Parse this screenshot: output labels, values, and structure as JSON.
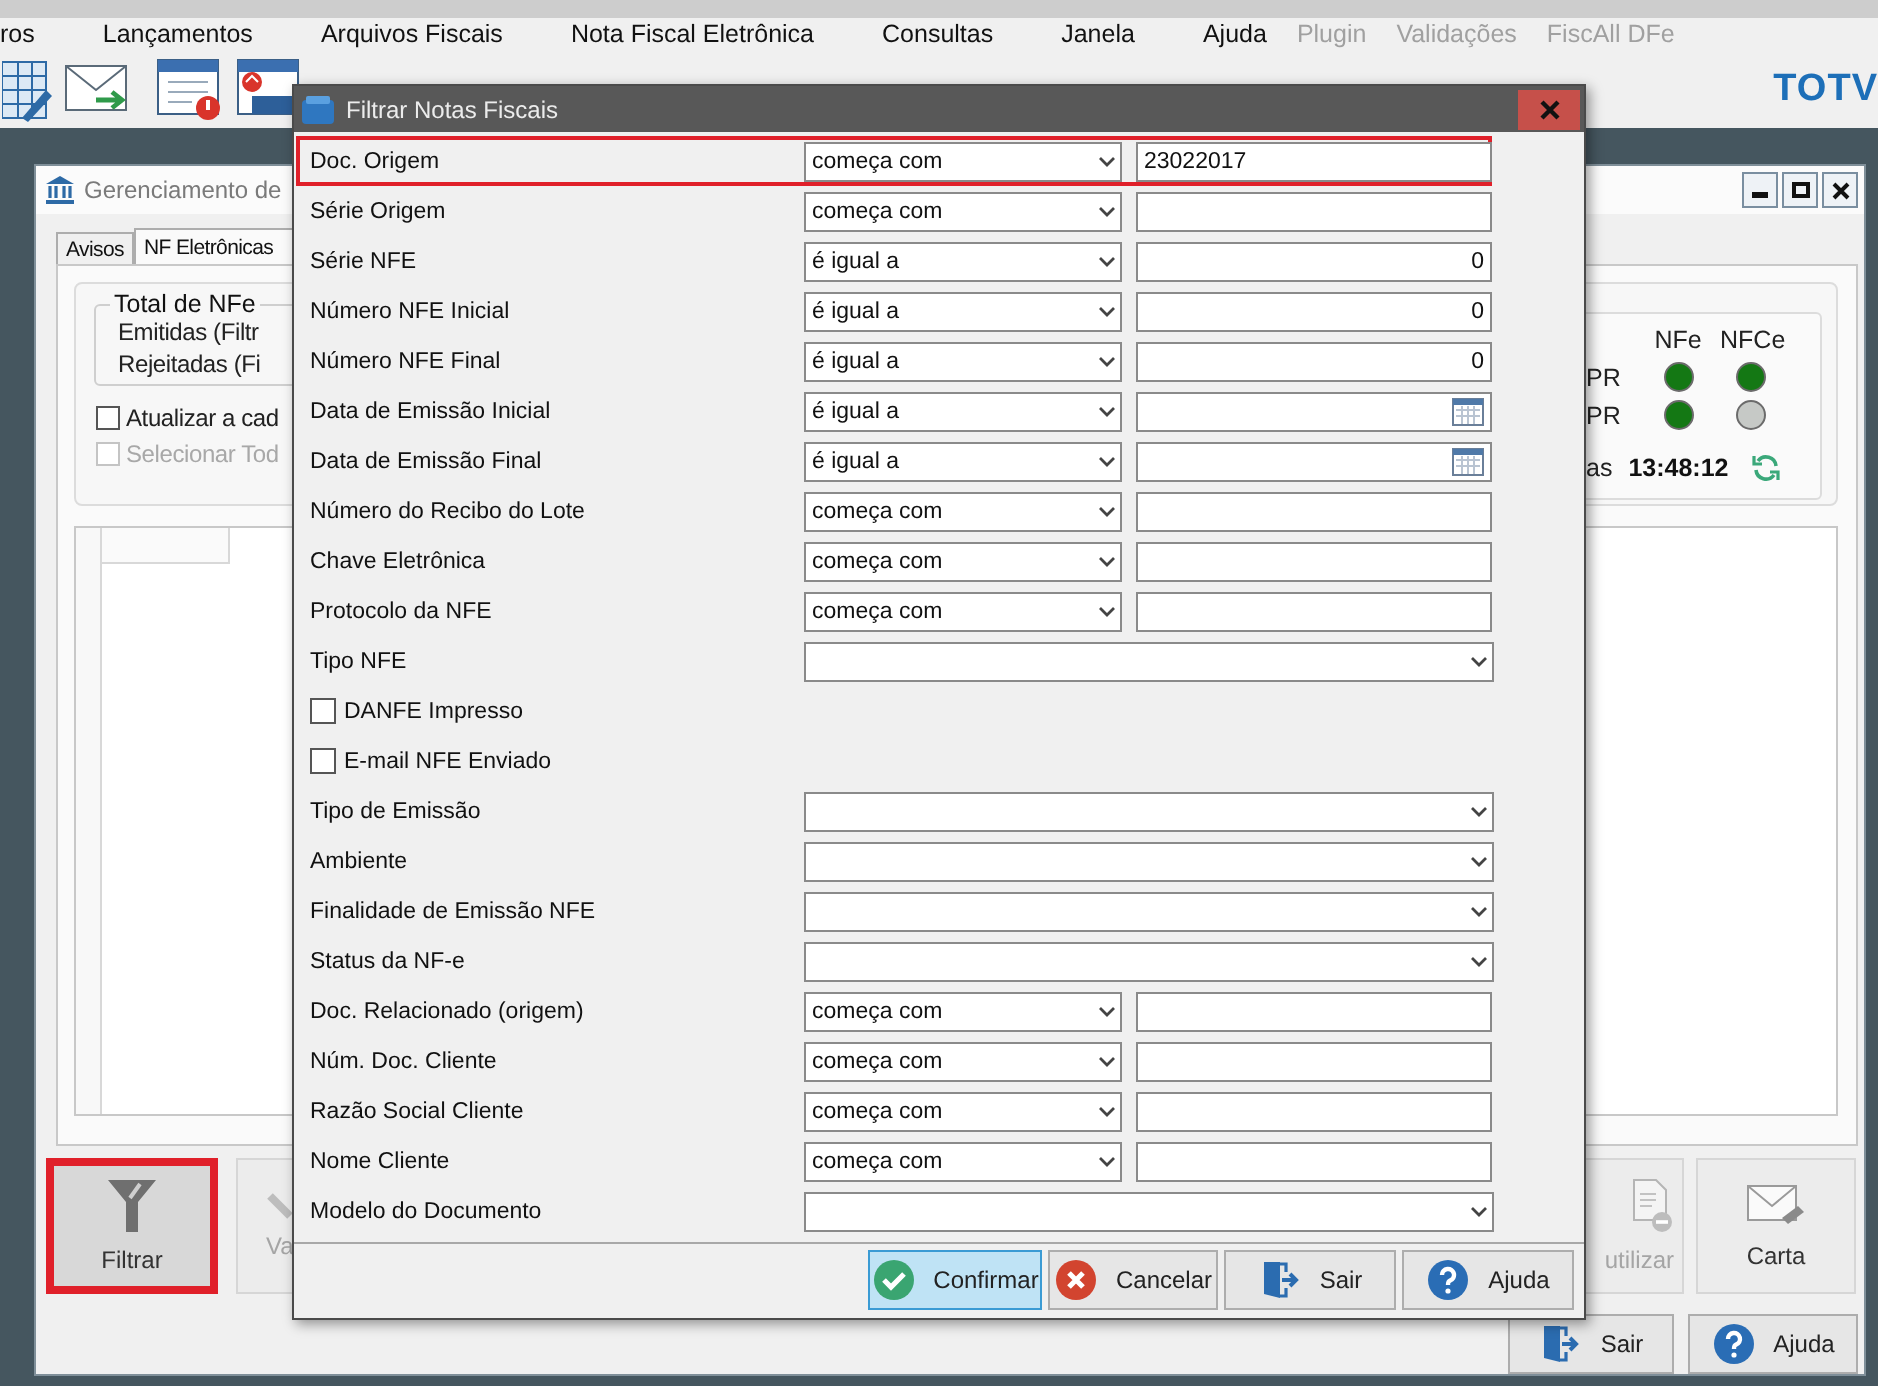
{
  "menu": [
    {
      "label": "ros",
      "disabled": false
    },
    {
      "label": "Lançamentos",
      "disabled": false
    },
    {
      "label": "Arquivos Fiscais",
      "disabled": false
    },
    {
      "label": "Nota Fiscal Eletrônica",
      "disabled": false
    },
    {
      "label": "Consultas",
      "disabled": false
    },
    {
      "label": "Janela",
      "disabled": false
    },
    {
      "label": "Ajuda",
      "disabled": false
    },
    {
      "label": "Plugin",
      "disabled": true
    },
    {
      "label": "Validações",
      "disabled": true
    },
    {
      "label": "FiscAll DFe",
      "disabled": true
    }
  ],
  "toolbar": {
    "tools": [
      {
        "kind": "grid"
      },
      {
        "kind": "mail"
      },
      {
        "kind": "calendar"
      },
      {
        "kind": "tax"
      }
    ],
    "brand": "TOTV"
  },
  "window": {
    "title": "Gerenciamento de",
    "tabs": [
      {
        "label": "Avisos",
        "selected": false
      },
      {
        "label": "NF Eletrônicas",
        "selected": true
      }
    ],
    "totals": {
      "title": "Total de NFe",
      "lines": [
        "Emitidas (Filtr",
        "Rejeitadas (Fi"
      ]
    },
    "options": [
      {
        "label": "Atualizar a cad",
        "checked": false,
        "disabled": false
      },
      {
        "label": "Selecionar Tod",
        "checked": false,
        "disabled": true
      }
    ],
    "status": {
      "columns": [
        "NFe",
        "NFCe"
      ],
      "rows": [
        {
          "label": "PR",
          "lights": [
            {
              "color": "#147814"
            },
            {
              "color": "#147814"
            }
          ]
        },
        {
          "label": "PR",
          "lights": [
            {
              "color": "#147814"
            },
            {
              "color": "#c6c9c6"
            }
          ]
        }
      ],
      "time_label": "as",
      "time": "13:48:12"
    },
    "actions": [
      {
        "label": "Filtrar",
        "kind": "filter",
        "disabled": false,
        "highlighted": true
      },
      {
        "label": "Va",
        "kind": "edit",
        "disabled": true,
        "highlighted": false
      }
    ],
    "right_actions": [
      {
        "label": "utilizar",
        "kind": "void",
        "disabled": true
      },
      {
        "label": "Carta",
        "kind": "letter",
        "disabled": false
      }
    ],
    "footer_buttons": [
      {
        "label": "Sair",
        "kind": "exit"
      },
      {
        "label": "Ajuda",
        "kind": "help"
      }
    ]
  },
  "dialog": {
    "title": "Filtrar Notas Fiscais",
    "fields": [
      {
        "kind": "text",
        "label": "Doc. Origem",
        "operator": "começa com",
        "value": "23022017",
        "highlighted": true
      },
      {
        "kind": "text",
        "label": "Série Origem",
        "operator": "começa com",
        "highlighted": false
      },
      {
        "kind": "number",
        "label": "Série NFE",
        "operator": "é igual a",
        "value": "0",
        "highlighted": false
      },
      {
        "kind": "number",
        "label": "Número NFE Inicial",
        "operator": "é igual a",
        "value": "0",
        "highlighted": false
      },
      {
        "kind": "number",
        "label": "Número NFE Final",
        "operator": "é igual a",
        "value": "0",
        "highlighted": false
      },
      {
        "kind": "date",
        "label": "Data de Emissão Inicial",
        "operator": "é igual a",
        "highlighted": false
      },
      {
        "kind": "date",
        "label": "Data de Emissão Final",
        "operator": "é igual a",
        "highlighted": false
      },
      {
        "kind": "text",
        "label": "Número do Recibo do Lote",
        "operator": "começa com",
        "highlighted": false
      },
      {
        "kind": "text",
        "label": "Chave Eletrônica",
        "operator": "começa com",
        "highlighted": false
      },
      {
        "kind": "text",
        "label": "Protocolo da NFE",
        "operator": "começa com",
        "highlighted": false
      },
      {
        "kind": "select",
        "label": "Tipo NFE",
        "highlighted": false
      },
      {
        "kind": "checkbox",
        "label": "DANFE Impresso",
        "checked": false,
        "highlighted": false
      },
      {
        "kind": "checkbox",
        "label": "E-mail NFE Enviado",
        "checked": false,
        "highlighted": false
      },
      {
        "kind": "select",
        "label": "Tipo de Emissão",
        "highlighted": false
      },
      {
        "kind": "select",
        "label": "Ambiente",
        "highlighted": false
      },
      {
        "kind": "select",
        "label": "Finalidade de Emissão NFE",
        "highlighted": false
      },
      {
        "kind": "select",
        "label": "Status da NF-e",
        "highlighted": false
      },
      {
        "kind": "text",
        "label": "Doc. Relacionado (origem)",
        "operator": "começa com",
        "highlighted": false
      },
      {
        "kind": "text",
        "label": "Núm. Doc. Cliente",
        "operator": "começa com",
        "highlighted": false
      },
      {
        "kind": "text",
        "label": "Razão Social Cliente",
        "operator": "começa com",
        "highlighted": false
      },
      {
        "kind": "text",
        "label": "Nome Cliente",
        "operator": "começa com",
        "highlighted": false
      },
      {
        "kind": "select",
        "label": "Modelo do Documento",
        "highlighted": false
      }
    ],
    "buttons": [
      {
        "label": "Confirmar",
        "kind": "confirm",
        "focused": true
      },
      {
        "label": "Cancelar",
        "kind": "cancel",
        "focused": false
      },
      {
        "label": "Sair",
        "kind": "exit",
        "focused": false
      },
      {
        "label": "Ajuda",
        "kind": "help",
        "focused": false
      }
    ]
  }
}
